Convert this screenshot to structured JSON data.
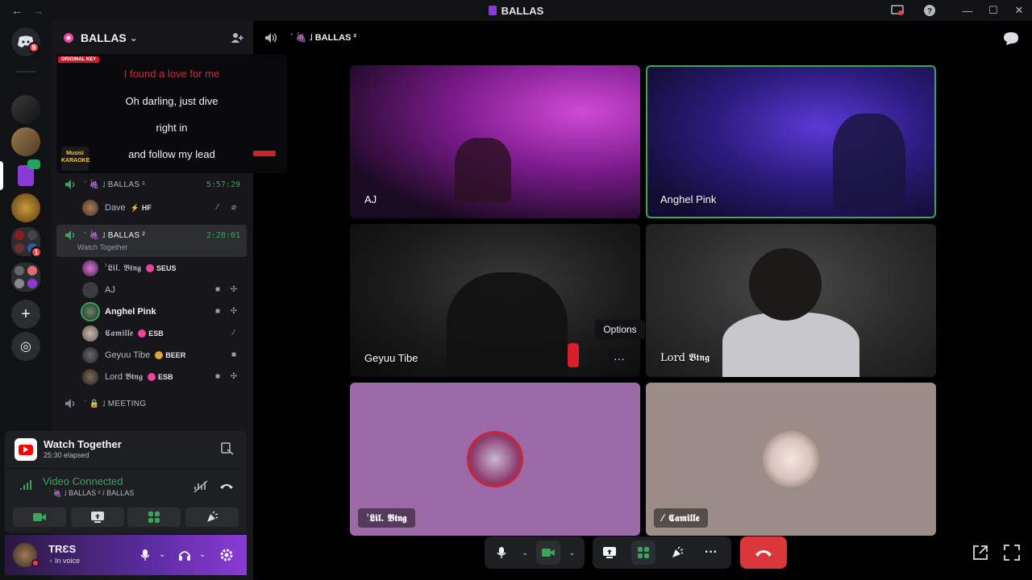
{
  "window": {
    "title": "BALLAS",
    "back_glyph": "←",
    "forward_glyph": "→",
    "controls": [
      "—",
      "☐",
      "✕"
    ]
  },
  "rail": {
    "home_badge": "9",
    "server_badge": "1",
    "add_glyph": "+",
    "explore_glyph": "◎"
  },
  "guild": {
    "name": "BALLAS",
    "chevron": "⌄"
  },
  "karaoke": {
    "badge": "ORIGINAL KEY",
    "lines": [
      "I found a love for me",
      "Oh darling, just dive",
      "right in",
      "and follow my lead"
    ],
    "logo_text": "Musisi KARAOKE",
    "highlight_color": "#e0213a"
  },
  "channels": {
    "ch1": {
      "label": "ʿ 🍇 ˩ BALLAS ¹",
      "time": "5:57:29"
    },
    "ch2": {
      "label": "ʿ 🍇 ˩ BALLAS ²",
      "time": "2:28:01",
      "activity": "Watch Together"
    },
    "ch3": {
      "label": "ʿ 🔒 ˩ MEETING"
    }
  },
  "members": {
    "dave": {
      "name": "Dave",
      "tag": "HF"
    },
    "lil": {
      "name": "ʾ𝕷𝖎𝖑. 𝕭𝖙𝖓𝖌",
      "tag": "SEUS"
    },
    "aj": {
      "name": "AJ"
    },
    "anghel": {
      "name": "Anghel Pink"
    },
    "camille": {
      "name": "𝕮𝖆𝖒𝖎𝖑𝖑𝖊",
      "tag": "ESB"
    },
    "geyuu": {
      "name": "Geyuu Tibe",
      "tag": "BEER"
    },
    "lord": {
      "name": "Lord 𝕭𝖙𝖓𝖌",
      "tag": "ESB"
    }
  },
  "watch_together": {
    "title": "Watch Together",
    "elapsed": "25:30 elapsed"
  },
  "voice": {
    "status": "Video Connected",
    "channel": "ʿ 🍇 ˩ BALLAS ² / BALLAS"
  },
  "user": {
    "name": "TRƐS",
    "status": "In voice"
  },
  "topbar": {
    "channel": "ʿ 🍇 ˩ BALLAS ²"
  },
  "tiles": {
    "aj": "AJ",
    "anghel": "Anghel Pink",
    "geyuu": "Geyuu Tibe",
    "lord": "Lord 𝕭𝖙𝖓𝖌",
    "lil": "ʾ𝕷𝖎𝖑. 𝕭𝖙𝖓𝖌",
    "camille": "𝕮𝖆𝖒𝖎𝖑𝖑𝖊"
  },
  "tooltip": "Options",
  "more_glyph": "···",
  "colors": {
    "accent_green": "#3ba55c",
    "hangup_red": "#da373c",
    "speaking_border": "#3ba55c"
  }
}
